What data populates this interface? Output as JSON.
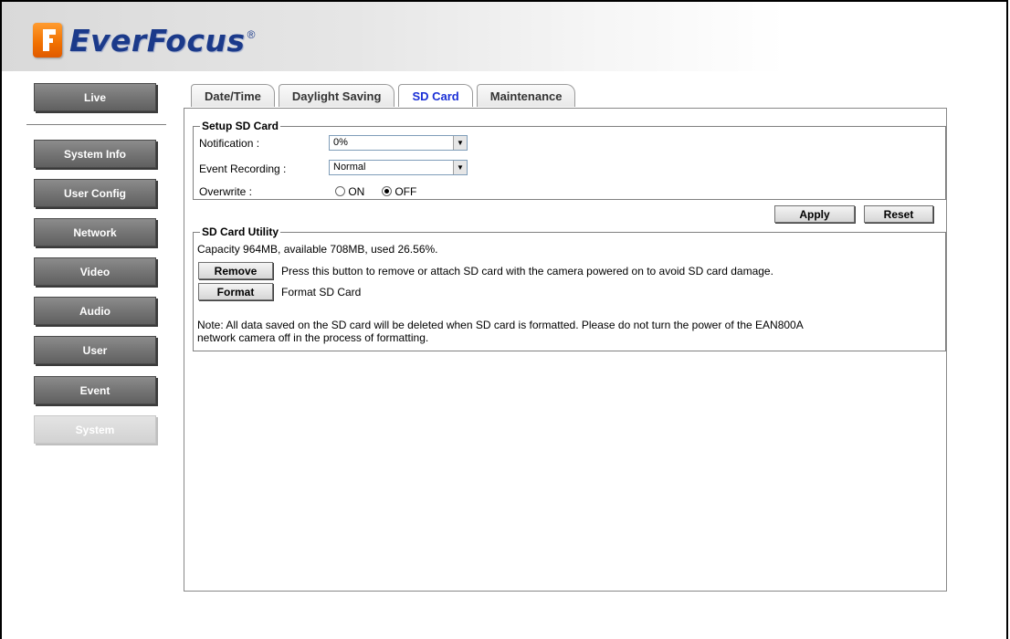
{
  "header": {
    "logo_text": "EverFocus",
    "logo_reg": "®"
  },
  "sidebar": {
    "items": [
      {
        "label": "Live"
      },
      {
        "label": "System Info"
      },
      {
        "label": "User Config"
      },
      {
        "label": "Network"
      },
      {
        "label": "Video"
      },
      {
        "label": "Audio"
      },
      {
        "label": "User"
      },
      {
        "label": "Event"
      },
      {
        "label": "System",
        "active": true
      }
    ]
  },
  "tabs": [
    {
      "label": "Date/Time"
    },
    {
      "label": "Daylight Saving"
    },
    {
      "label": "SD Card",
      "active": true
    },
    {
      "label": "Maintenance"
    }
  ],
  "setup": {
    "legend": "Setup SD Card",
    "notification_label": "Notification :",
    "notification_value": "0%",
    "event_recording_label": "Event Recording :",
    "event_recording_value": "Normal",
    "overwrite_label": "Overwrite :",
    "overwrite_on": "ON",
    "overwrite_off": "OFF",
    "overwrite_selected": "OFF"
  },
  "actions": {
    "apply": "Apply",
    "reset": "Reset"
  },
  "utility": {
    "legend": "SD Card Utility",
    "capacity": "Capacity 964MB, available 708MB, used 26.56%.",
    "remove_button": "Remove",
    "remove_desc": "Press this button to remove or attach SD card with the camera powered on to avoid SD card damage.",
    "format_button": "Format",
    "format_desc": "Format SD Card",
    "note_line1": "Note: All data saved on the SD card will be deleted when SD card is formatted. Please do not turn the power of the EAN800A",
    "note_line2": "network camera off in the process of formatting."
  },
  "colors": {
    "logo_orange": "#f07000",
    "logo_blue": "#1b3a8a",
    "active_tab": "#1a2fd6",
    "side_button": "#777777"
  },
  "icons": {
    "logo": "everfocus-f-logo",
    "dropdown": "chevron-down-icon",
    "radio": "radio-icon"
  }
}
